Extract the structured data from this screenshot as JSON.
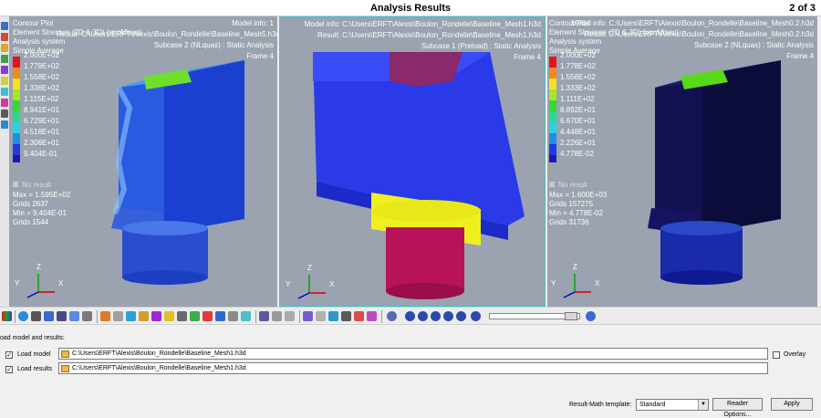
{
  "window": {
    "title": "Analysis Results",
    "page_indicator": "2 of 3"
  },
  "colors": {
    "viewport_bg": "#9aa3af",
    "active_border": "#35c5cf"
  },
  "legend_colors": [
    "#e8121c",
    "#f08a1e",
    "#f5e21e",
    "#a8e628",
    "#36d838",
    "#28d895",
    "#26d4e0",
    "#1f8ee8",
    "#2038e0",
    "#1a1aa8"
  ],
  "viewports": [
    {
      "plot_title": "Contour Plot",
      "overlap_line": "Element Stresses (2D & 3D) (vonMises)",
      "result_line": "Result: C:\\Users\\ERFT\\Alexis\\Boulon_Rondelle\\Baseline_Mesh5.h3d",
      "model_info": "Model info: 1",
      "analysis": "Analysis system",
      "average": "Simple Average",
      "legend": [
        "2.000E+02",
        "1.779E+02",
        "1.558E+02",
        "1.336E+02",
        "1.115E+02",
        "8.941E+01",
        "6.729E+01",
        "4.518E+01",
        "2.306E+01",
        "9.404E-01"
      ],
      "no_result": "No result",
      "stats": [
        "Max = 1.595E+02",
        "Grids 2637",
        "Min = 9.404E-01",
        "Grids 1544"
      ],
      "subcase": "Subcase 2 (NLquas) : Static Analysis",
      "frame": "Frame 4",
      "axis": {
        "x": "X",
        "y": "Y",
        "z": "Z"
      }
    },
    {
      "model_info": "Model info: C:\\Users\\ERFT\\Alexis\\Boulon_Rondelle\\Baseline_Mesh1.h3d",
      "result_line": "Result: C:\\Users\\ERFT\\Alexis\\Boulon_Rondelle\\Baseline_Mesh1.h3d",
      "subcase": "Subcase 1 (Preload) : Static Analysis",
      "frame": "Frame 4",
      "axis": {
        "x": "X",
        "y": "Y",
        "z": "Z"
      }
    },
    {
      "plot_title": "Contour Plot",
      "overlap_line": "Element Stresses (2D & 3D) (vonMises)",
      "model_info": "Model info: C:\\Users\\ERFT\\Alexis\\Boulon_Rondelle\\Baseline_Mesh0.2.h3d",
      "result_line": "Result: C:\\Users\\ERFT\\Alexis\\Boulon_Rondelle\\Baseline_Mesh0.2.h3d",
      "analysis": "Analysis system",
      "average": "Simple Average",
      "legend": [
        "2.000E+02",
        "1.778E+02",
        "1.556E+02",
        "1.333E+02",
        "1.111E+02",
        "8.892E+01",
        "6.670E+01",
        "4.448E+01",
        "2.226E+01",
        "4.778E-02"
      ],
      "no_result": "No result",
      "stats": [
        "Max = 1.600E+03",
        "Grids 157275",
        "Min = 4.778E-02",
        "Grids 31736"
      ],
      "subcase": "Subcase 2 (NLquas) : Static Analysis",
      "frame": "Frame 4",
      "axis": {
        "x": "X",
        "y": "Y",
        "z": "Z"
      }
    }
  ],
  "panel": {
    "title": "oad model and results:",
    "load_model_label": "Load model",
    "load_model_path": "C:\\Users\\ERFT\\Alexis\\Boulon_Rondelle\\Baseline_Mesh1.h3d",
    "load_results_label": "Load results",
    "load_results_path": "C:\\Users\\ERFT\\Alexis\\Boulon_Rondelle\\Baseline_Mesh1.h3d",
    "overlay_label": "Overlay",
    "result_math_label": "Result-Math template:",
    "template_value": "Standard",
    "reader_options_label": "Reader Options...",
    "apply_label": "Apply"
  }
}
